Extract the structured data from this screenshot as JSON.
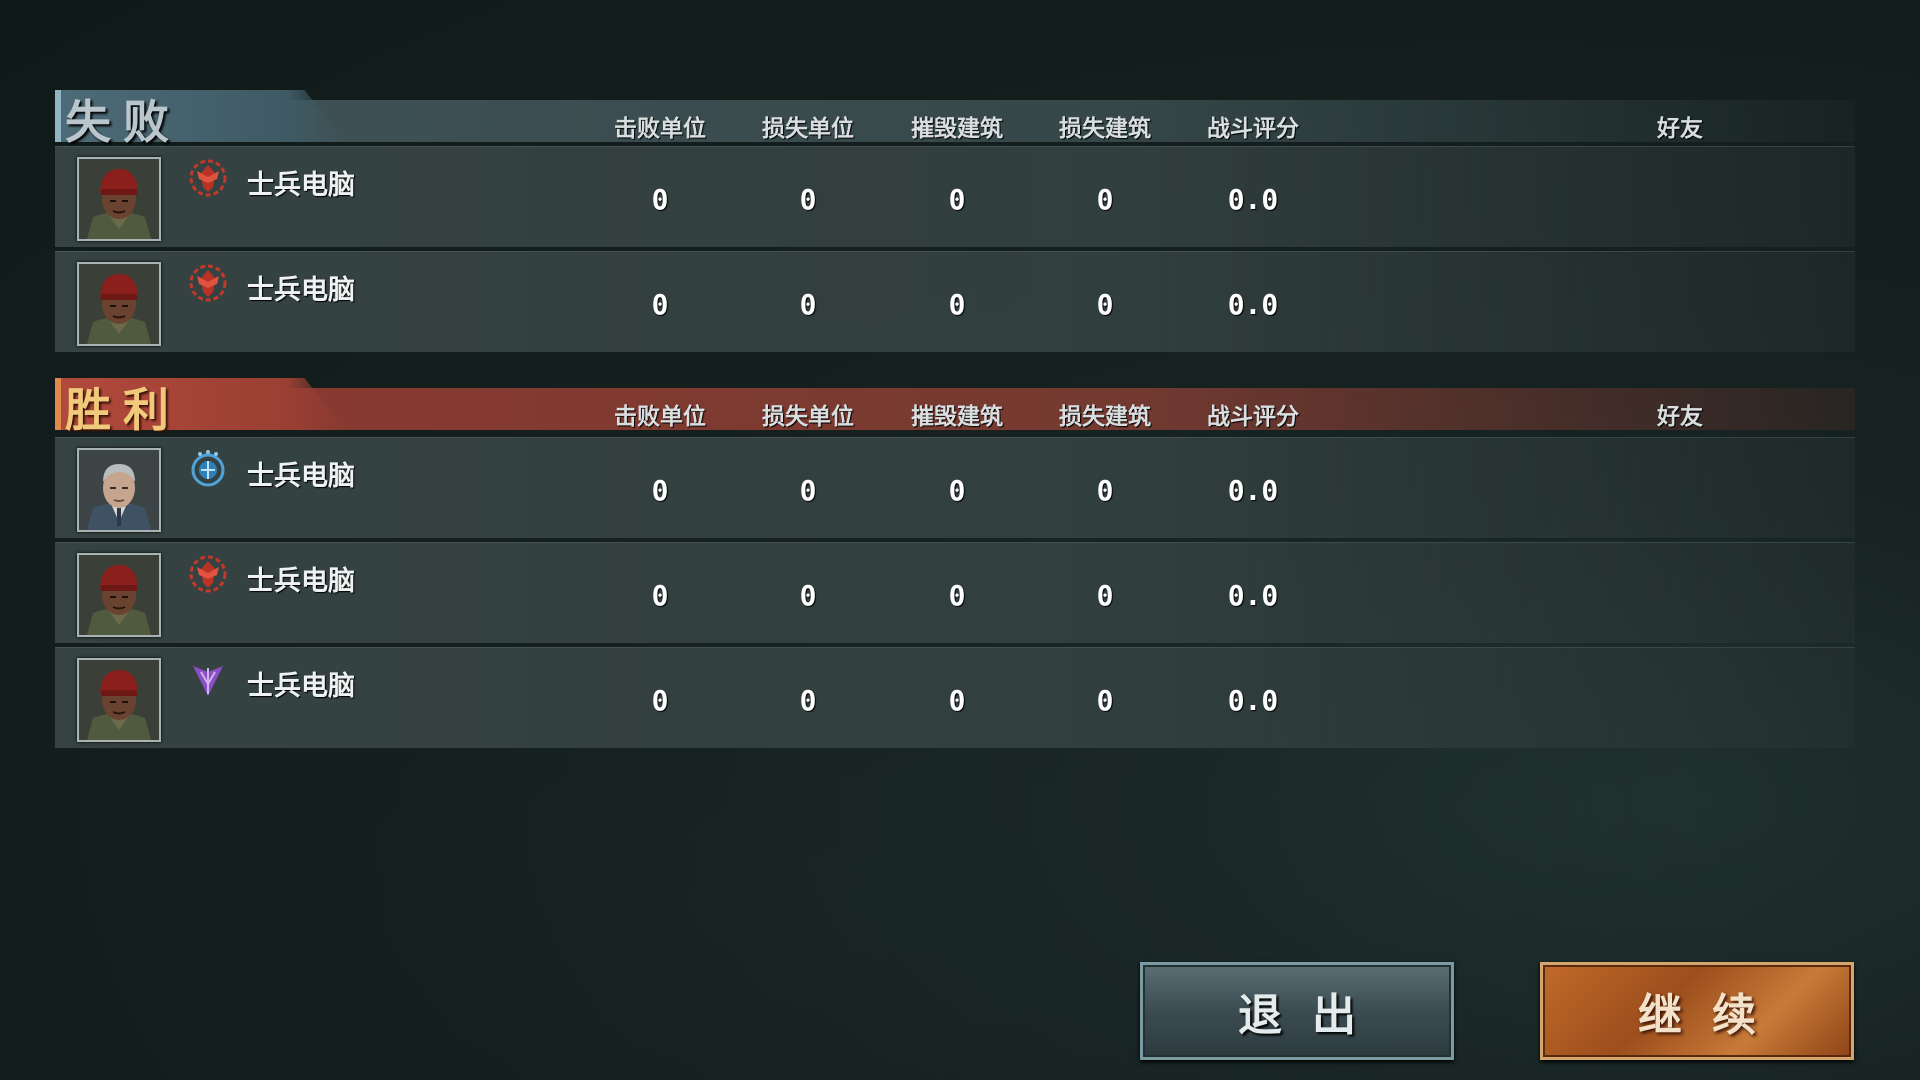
{
  "columns": [
    "击败单位",
    "损失单位",
    "摧毁建筑",
    "损失建筑",
    "战斗评分"
  ],
  "friend_label": "好友",
  "sections": {
    "defeat": {
      "title": "失败",
      "players": [
        {
          "name": "士兵电脑",
          "faction_icon": "red-eagle-emblem-icon",
          "stats": [
            "0",
            "0",
            "0",
            "0",
            "0.0"
          ]
        },
        {
          "name": "士兵电脑",
          "faction_icon": "red-eagle-emblem-icon",
          "stats": [
            "0",
            "0",
            "0",
            "0",
            "0.0"
          ]
        }
      ]
    },
    "victory": {
      "title": "胜利",
      "players": [
        {
          "name": "士兵电脑",
          "faction_icon": "blue-globe-emblem-icon",
          "stats": [
            "0",
            "0",
            "0",
            "0",
            "0.0"
          ]
        },
        {
          "name": "士兵电脑",
          "faction_icon": "red-eagle-emblem-icon",
          "stats": [
            "0",
            "0",
            "0",
            "0",
            "0.0"
          ]
        },
        {
          "name": "士兵电脑",
          "faction_icon": "purple-trident-emblem-icon",
          "stats": [
            "0",
            "0",
            "0",
            "0",
            "0.0"
          ]
        }
      ]
    }
  },
  "buttons": {
    "exit": "退出",
    "continue": "继续"
  },
  "colors": {
    "defeat_accent": "#4d6b78",
    "victory_accent": "#b24a3c",
    "victory_title": "#f1c97a",
    "continue_button": "#c26a2a"
  }
}
